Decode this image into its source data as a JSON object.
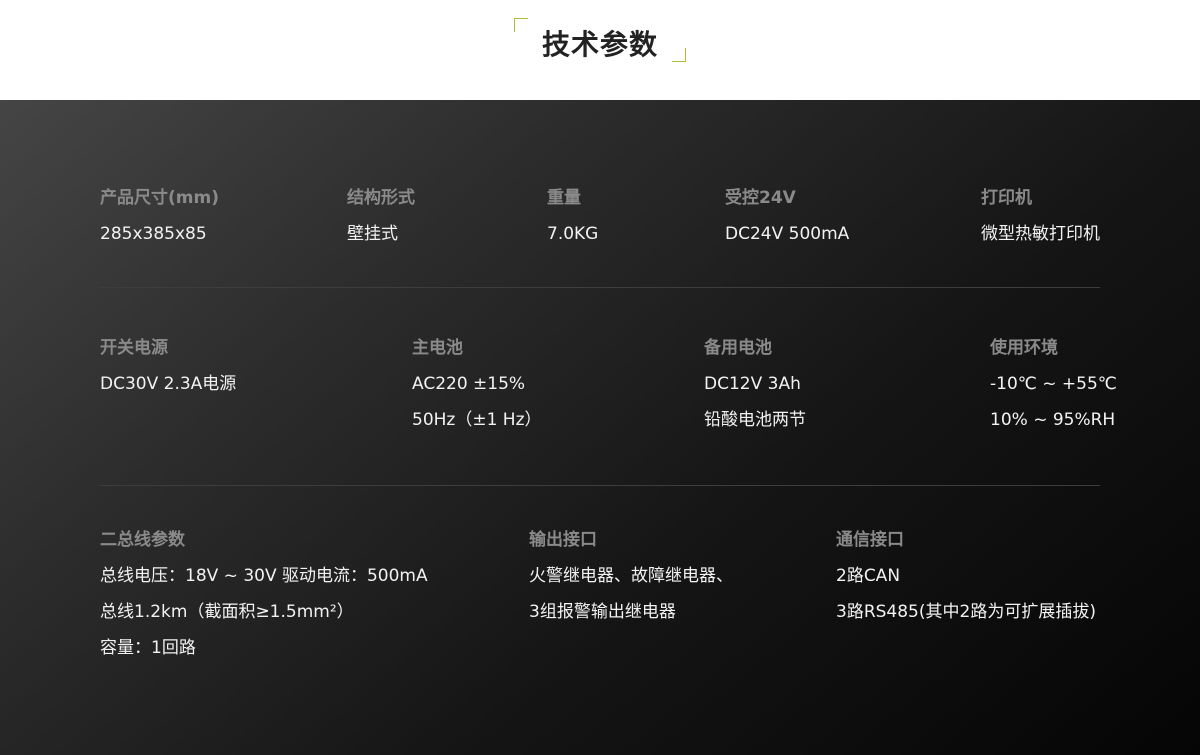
{
  "header": {
    "title": "技术参数"
  },
  "row1": [
    {
      "label": "产品尺寸(mm)",
      "values": [
        "285x385x85"
      ]
    },
    {
      "label": "结构形式",
      "values": [
        "壁挂式"
      ]
    },
    {
      "label": "重量",
      "values": [
        "7.0KG"
      ]
    },
    {
      "label": "受控24V",
      "values": [
        "DC24V 500mA"
      ]
    },
    {
      "label": "打印机",
      "values": [
        "微型热敏打印机"
      ]
    }
  ],
  "row2": [
    {
      "label": "开关电源",
      "values": [
        "DC30V 2.3A电源"
      ]
    },
    {
      "label": "主电池",
      "values": [
        "AC220 ±15%",
        "50Hz（±1 Hz）"
      ]
    },
    {
      "label": "备用电池",
      "values": [
        "DC12V 3Ah",
        "铅酸电池两节"
      ]
    },
    {
      "label": "使用环境",
      "values": [
        "-10℃ ~ +55℃",
        "10% ~ 95%RH"
      ]
    }
  ],
  "row3": [
    {
      "label": "二总线参数",
      "values": [
        "总线电压：18V ~ 30V 驱动电流：500mA",
        "总线1.2km（截面积≥1.5mm²）",
        "容量：1回路"
      ]
    },
    {
      "label": "输出接口",
      "values": [
        "火警继电器、故障继电器、",
        "3组报警输出继电器"
      ]
    },
    {
      "label": "通信接口",
      "values": [
        "2路CAN",
        "3路RS485(其中2路为可扩展插拔)"
      ]
    }
  ]
}
